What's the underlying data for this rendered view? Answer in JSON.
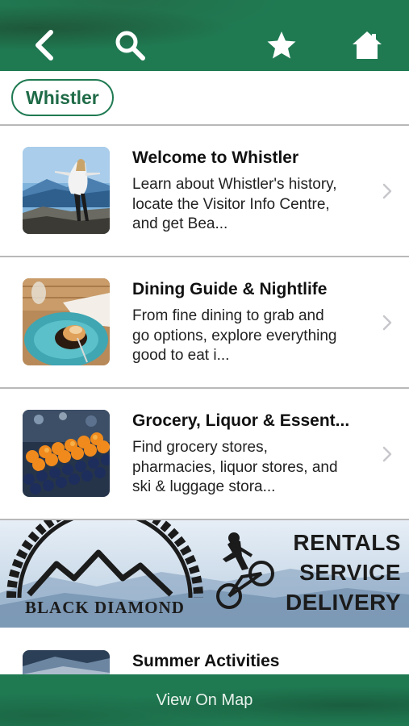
{
  "colors": {
    "brand_green": "#1f7a52",
    "divider": "#b9b9b9",
    "chevron": "#c7c7cc"
  },
  "nav": {
    "icons": [
      "back-icon",
      "search-icon",
      "star-icon",
      "home-icon"
    ]
  },
  "filter": {
    "chip_label": "Whistler"
  },
  "items": [
    {
      "title": "Welcome to Whistler",
      "description": "Learn about Whistler's history, locate the Visitor Info Centre, and get Bea...",
      "icon": "chevron-right-icon"
    },
    {
      "title": "Dining Guide & Nightlife",
      "description": "From fine dining to grab and go options, explore everything good to eat i...",
      "icon": "chevron-right-icon"
    },
    {
      "title": "Grocery, Liquor & Essent...",
      "description": "Find grocery stores, pharmacies, liquor stores, and ski & luggage stora...",
      "icon": "chevron-right-icon"
    },
    {
      "title": "Summer Activities"
    }
  ],
  "banner": {
    "brand": "BLACK DIAMOND",
    "line1": "RENTALS",
    "line2": "SERVICE",
    "line3": "DELIVERY"
  },
  "bottom_bar": {
    "label": "View On Map"
  }
}
